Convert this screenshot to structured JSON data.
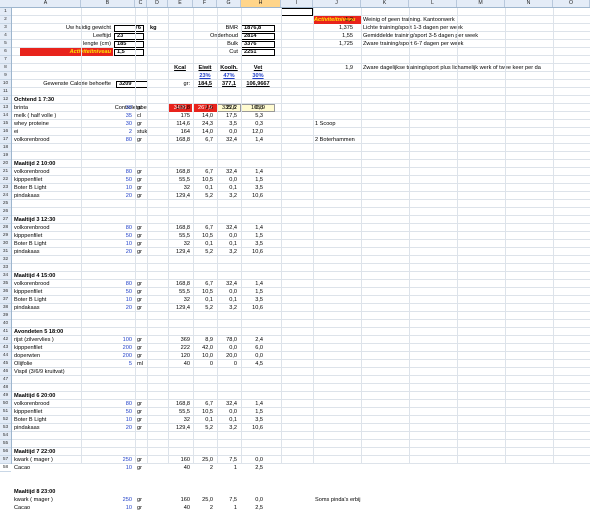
{
  "columns": [
    "A",
    "B",
    "C",
    "D",
    "E",
    "F",
    "G",
    "H",
    "I",
    "J",
    "K",
    "L",
    "M",
    "N",
    "O"
  ],
  "rows_visible": 58,
  "inputs": {
    "weight_label": "Uw huidig gewicht",
    "weight_value": "76",
    "weight_unit": "kg",
    "age_label": "Leeftijd",
    "age_value": "23",
    "length_label": "lengte (cm)",
    "length_value": "185",
    "activity_label": "Activiteitniveau",
    "activity_value": "1,5",
    "calorie_label": "Gewenste Calorie behoefte",
    "calorie_value": "3209"
  },
  "metrics": {
    "bmr_label": "BMR",
    "bmr_value": "1876,8",
    "onderhoud_label": "Onderhoud",
    "onderhoud_value": "2814",
    "bulk_label": "Bulk",
    "bulk_value": "3376",
    "cut_label": "Cut",
    "cut_value": "2251"
  },
  "macro_header": {
    "kcal": "Kcal",
    "eiwit": "Eiwit",
    "kooh": "Koolh.",
    "vet": "Vet",
    "pct_eiwit": "23%",
    "pct_kooh": "47%",
    "pct_vet": "30%",
    "gr_label": "gr:",
    "gr_eiwit": "184,5",
    "gr_kooh": "377,1",
    "gr_vet": "106,9667"
  },
  "controle": {
    "label": "Controletabel",
    "kcal": "3426",
    "eiwit": "267,9",
    "kooh": "335,6",
    "vet": "105,9"
  },
  "activity_table": {
    "title": "Activiteitniveau",
    "rows": [
      {
        "v": "1,2",
        "d": "Weinig of geen training. Kantoorwerk"
      },
      {
        "v": "1,375",
        "d": "Lichte training/sport 1-3 dagen per week"
      },
      {
        "v": "1,55",
        "d": "Gemiddelde training/sport 3-5 dagen per week"
      },
      {
        "v": "1,725",
        "d": "Zware training/sport 6-7 dagen per week"
      },
      {
        "v": "1,9",
        "d": "Zware dagelijkse training/sport plus lichamelijk werk of twee keer per da"
      }
    ]
  },
  "meals": [
    {
      "title": "Ochtend 1 7:30",
      "items": [
        {
          "n": "brinta",
          "q": "30",
          "u": "gr",
          "k": "109,8",
          "e": "3,6",
          "c": "22,2",
          "f": "0,8"
        },
        {
          "n": "melk ( half volle )",
          "q": "35",
          "u": "cl",
          "k": "175",
          "e": "14,0",
          "c": "17,5",
          "f": "5,3"
        },
        {
          "n": "whey proteine",
          "q": "30",
          "u": "gr",
          "k": "114,6",
          "e": "24,3",
          "c": "3,5",
          "f": "0,3",
          "note": "1 Scoop"
        },
        {
          "n": "ei",
          "q": "2",
          "u": "stuk",
          "k": "164",
          "e": "14,0",
          "c": "0,0",
          "f": "12,0"
        },
        {
          "n": "volkorenbrood",
          "q": "80",
          "u": "gr",
          "k": "168,8",
          "e": "6,7",
          "c": "32,4",
          "f": "1,4",
          "note": "2 Boterhammen"
        }
      ]
    },
    {
      "title": "Maaltijd 2 10:00",
      "items": [
        {
          "n": "volkorenbrood",
          "q": "80",
          "u": "gr",
          "k": "168,8",
          "e": "6,7",
          "c": "32,4",
          "f": "1,4"
        },
        {
          "n": "kipppenfilet",
          "q": "50",
          "u": "gr",
          "k": "55,5",
          "e": "10,5",
          "c": "0,0",
          "f": "1,5"
        },
        {
          "n": "Boter B Light",
          "q": "10",
          "u": "gr",
          "k": "32",
          "e": "0,1",
          "c": "0,1",
          "f": "3,5"
        },
        {
          "n": "pindakaas",
          "q": "20",
          "u": "gr",
          "k": "129,4",
          "e": "5,2",
          "c": "3,2",
          "f": "10,6"
        }
      ]
    },
    {
      "title": "Maaltijd 3 12:30",
      "items": [
        {
          "n": "volkorenbrood",
          "q": "80",
          "u": "gr",
          "k": "168,8",
          "e": "6,7",
          "c": "32,4",
          "f": "1,4"
        },
        {
          "n": "kipppenfilet",
          "q": "50",
          "u": "gr",
          "k": "55,5",
          "e": "10,5",
          "c": "0,0",
          "f": "1,5"
        },
        {
          "n": "Boter B Light",
          "q": "10",
          "u": "gr",
          "k": "32",
          "e": "0,1",
          "c": "0,1",
          "f": "3,5"
        },
        {
          "n": "pindakaas",
          "q": "20",
          "u": "gr",
          "k": "129,4",
          "e": "5,2",
          "c": "3,2",
          "f": "10,6"
        }
      ]
    },
    {
      "title": "Maaltijd 4 15:00",
      "items": [
        {
          "n": "volkorenbrood",
          "q": "80",
          "u": "gr",
          "k": "168,8",
          "e": "6,7",
          "c": "32,4",
          "f": "1,4"
        },
        {
          "n": "kipppenfilet",
          "q": "50",
          "u": "gr",
          "k": "55,5",
          "e": "10,5",
          "c": "0,0",
          "f": "1,5"
        },
        {
          "n": "Boter B Light",
          "q": "10",
          "u": "gr",
          "k": "32",
          "e": "0,1",
          "c": "0,1",
          "f": "3,5"
        },
        {
          "n": "pindakaas",
          "q": "20",
          "u": "gr",
          "k": "129,4",
          "e": "5,2",
          "c": "3,2",
          "f": "10,6"
        }
      ]
    },
    {
      "title": "Avondeten 5 18:00",
      "items": [
        {
          "n": "rijst (zilvervlies )",
          "q": "100",
          "u": "gr",
          "k": "369",
          "e": "8,9",
          "c": "78,0",
          "f": "2,4"
        },
        {
          "n": "kipppenfilet",
          "q": "200",
          "u": "gr",
          "k": "222",
          "e": "42,0",
          "c": "0,0",
          "f": "6,0"
        },
        {
          "n": "doperwten",
          "q": "200",
          "u": "gr",
          "k": "120",
          "e": "10,0",
          "c": "20,0",
          "f": "0,0"
        },
        {
          "n": "Olijfolie",
          "q": "5",
          "u": "ml",
          "k": "40",
          "e": "0",
          "c": "0",
          "f": "4,5"
        },
        {
          "n": "Vispil (3/6/9 kruitvat)",
          "q": "",
          "u": "",
          "k": "",
          "e": "",
          "c": "",
          "f": ""
        }
      ]
    },
    {
      "title": "Maaltijd 6 20:00",
      "items": [
        {
          "n": "volkorenbrood",
          "q": "80",
          "u": "gr",
          "k": "168,8",
          "e": "6,7",
          "c": "32,4",
          "f": "1,4"
        },
        {
          "n": "kipppenfilet",
          "q": "50",
          "u": "gr",
          "k": "55,5",
          "e": "10,5",
          "c": "0,0",
          "f": "1,5"
        },
        {
          "n": "Boter B Light",
          "q": "10",
          "u": "gr",
          "k": "32",
          "e": "0,1",
          "c": "0,1",
          "f": "3,5"
        },
        {
          "n": "pindakaas",
          "q": "20",
          "u": "gr",
          "k": "129,4",
          "e": "5,2",
          "c": "3,2",
          "f": "10,6"
        }
      ]
    },
    {
      "title": "Maaltijd 7 22:00",
      "items": [
        {
          "n": "kwark ( mager )",
          "q": "250",
          "u": "gr",
          "k": "160",
          "e": "25,0",
          "c": "7,5",
          "f": "0,0"
        },
        {
          "n": "Cacao",
          "q": "10",
          "u": "gr",
          "k": "40",
          "e": "2",
          "c": "1",
          "f": "2,5"
        }
      ]
    },
    {
      "title": "Maaltijd 8 23:00",
      "items": [
        {
          "n": "kwark ( mager )",
          "q": "250",
          "u": "gr",
          "k": "160",
          "e": "25,0",
          "c": "7,5",
          "f": "0,0",
          "note": "Soms pinda's erbij"
        },
        {
          "n": "Cacao",
          "q": "10",
          "u": "gr",
          "k": "40",
          "e": "2",
          "c": "1",
          "f": "2,5"
        }
      ]
    }
  ]
}
